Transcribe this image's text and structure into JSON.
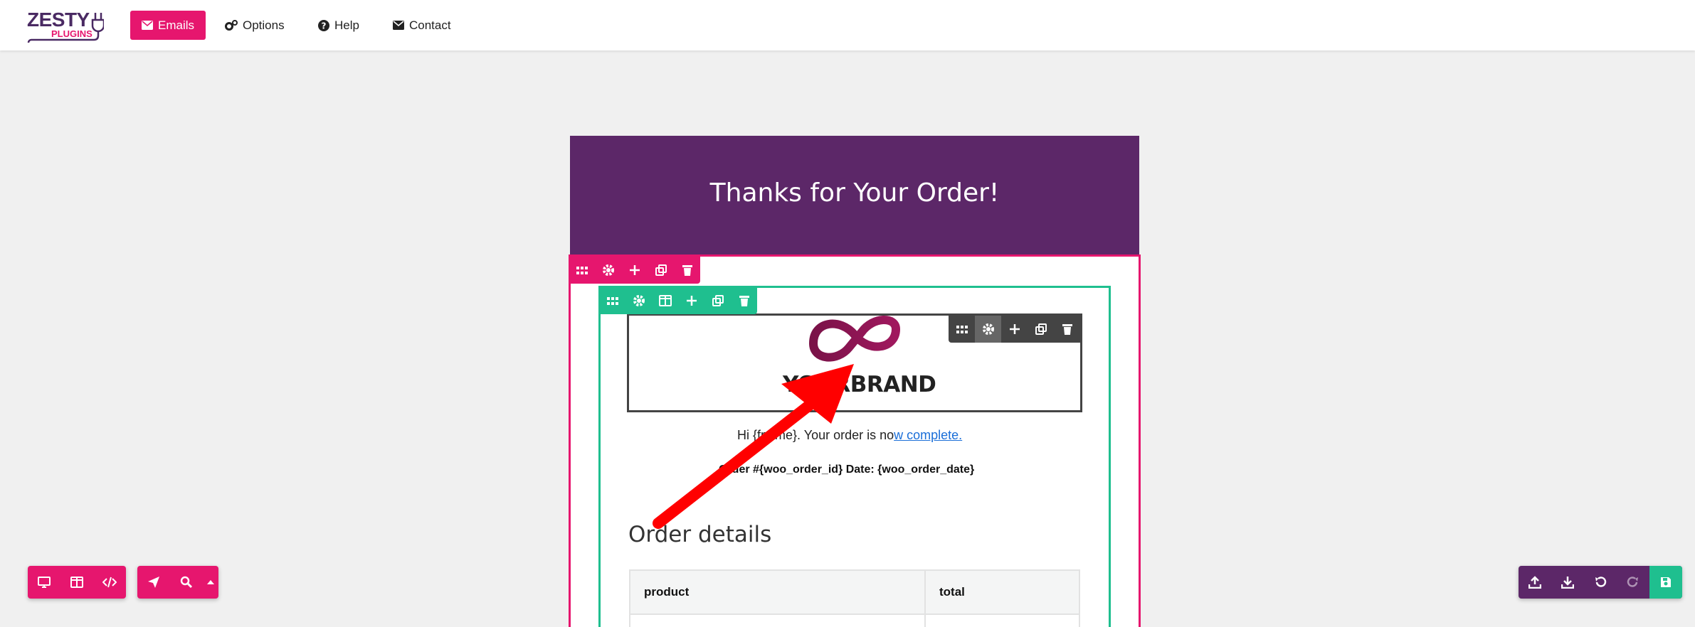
{
  "brand": {
    "logo_top": "ZESTY",
    "logo_bottom": "PLUGINS"
  },
  "nav": [
    {
      "label": "Emails",
      "icon": "envelope-icon",
      "active": true
    },
    {
      "label": "Options",
      "icon": "gears-icon",
      "active": false
    },
    {
      "label": "Help",
      "icon": "question-circle-icon",
      "active": false
    },
    {
      "label": "Contact",
      "icon": "envelope-icon",
      "active": false
    }
  ],
  "email": {
    "title": "Thanks for Your Order!",
    "brand_text": "YOURBRAND",
    "greeting_pre": "Hi {fname}.  Your order is no",
    "greeting_link": "w complete.",
    "order_line": "Order #{woo_order_id} Date: {woo_order_date}",
    "order_details": "Order details",
    "table_headers": [
      "product",
      "total"
    ]
  },
  "colors": {
    "accent": "#e6166e",
    "purple": "#5c2768",
    "green": "#1fbf8f",
    "dark": "#444444"
  }
}
